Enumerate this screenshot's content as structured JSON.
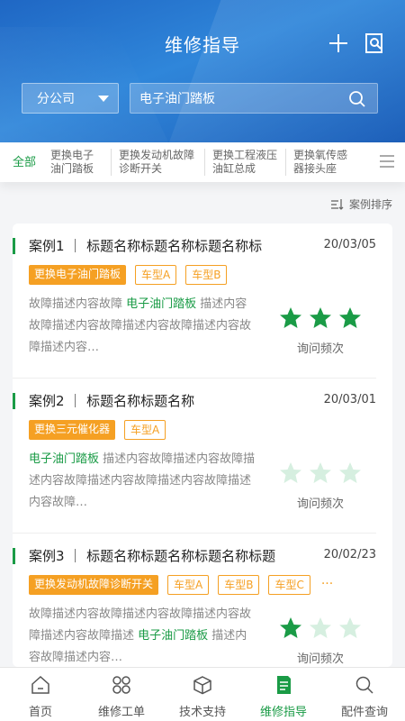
{
  "header": {
    "title": "维修指导",
    "branch": "分公司",
    "search_value": "电子油门踏板"
  },
  "tabs": {
    "all": "全部",
    "items": [
      "更换电子油门踏板",
      "更换发动机故障诊断开关",
      "更换工程液压油缸总成",
      "更换氧传感器接头座"
    ]
  },
  "sort_label": "案例排序",
  "cases": [
    {
      "title": "案例1 ｜ 标题名称标题名称标题名称标",
      "date": "20/03/05",
      "tag": "更换电子油门踏板",
      "models": [
        "车型A",
        "车型B"
      ],
      "desc_pre": "故障描述内容故障 ",
      "desc_hl": "电子油门踏板",
      "desc_post": " 描述内容故障描述内容故障描述内容故障描述内容故障描述内容…",
      "rating": 3,
      "freq_label": "询问频次"
    },
    {
      "title": "案例2 ｜ 标题名称标题名称",
      "date": "20/03/01",
      "tag": "更换三元催化器",
      "models": [
        "车型A"
      ],
      "desc_pre": "",
      "desc_hl": "电子油门踏板",
      "desc_post": " 描述内容故障描述内容故障描述内容故障描述内容故障描述内容故障描述内容故障…",
      "rating": 0,
      "freq_label": "询问频次"
    },
    {
      "title": "案例3 ｜ 标题名称标题名称标题名称标题",
      "date": "20/02/23",
      "tag": "更换发动机故障诊断开关",
      "models": [
        "车型A",
        "车型B",
        "车型C"
      ],
      "desc_pre": "故障描述内容故障描述内容故障描述内容故障描述内容故障描述 ",
      "desc_hl": "电子油门踏板",
      "desc_post": " 描述内容故障描述内容…",
      "rating": 1,
      "freq_label": "询问频次"
    }
  ],
  "more_symbol": "···",
  "nav": [
    {
      "label": "首页",
      "icon": "home-icon"
    },
    {
      "label": "维修工单",
      "icon": "grid-icon"
    },
    {
      "label": "技术支持",
      "icon": "cube-icon"
    },
    {
      "label": "维修指导",
      "icon": "guide-icon"
    },
    {
      "label": "配件查询",
      "icon": "search-icon"
    }
  ],
  "colors": {
    "accent": "#1a9b46",
    "tag": "#f5a023",
    "header": "#2f86da"
  }
}
